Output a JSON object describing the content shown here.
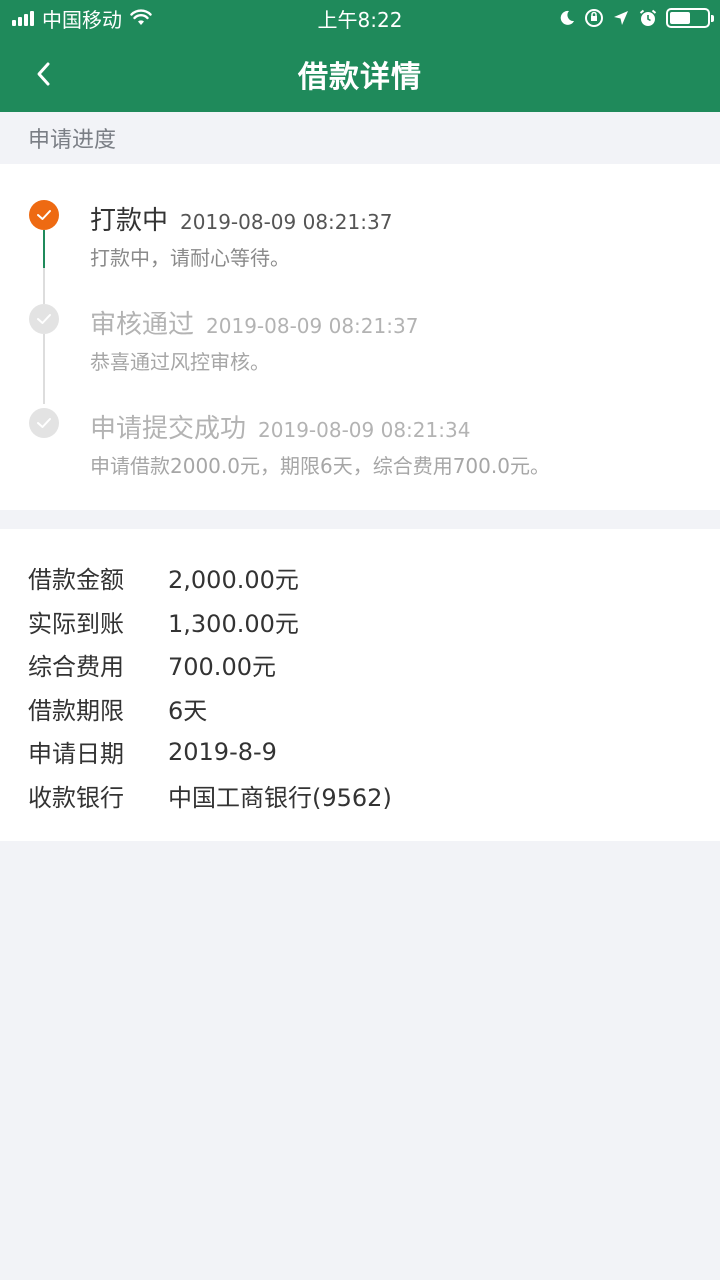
{
  "status_bar": {
    "carrier": "中国移动",
    "time": "上午8:22"
  },
  "header": {
    "title": "借款详情"
  },
  "progress": {
    "section_title": "申请进度",
    "steps": [
      {
        "title": "打款中",
        "time": "2019-08-09 08:21:37",
        "desc": "打款中，请耐心等待。",
        "state": "active"
      },
      {
        "title": "审核通过",
        "time": "2019-08-09 08:21:37",
        "desc": "恭喜通过风控审核。",
        "state": "done"
      },
      {
        "title": "申请提交成功",
        "time": "2019-08-09 08:21:34",
        "desc": "申请借款2000.0元，期限6天，综合费用700.0元。",
        "state": "done"
      }
    ]
  },
  "details": [
    {
      "label": "借款金额",
      "value": "2,000.00元"
    },
    {
      "label": "实际到账",
      "value": "1,300.00元"
    },
    {
      "label": "综合费用",
      "value": "700.00元"
    },
    {
      "label": "借款期限",
      "value": "6天"
    },
    {
      "label": "申请日期",
      "value": "2019-8-9"
    },
    {
      "label": "收款银行",
      "value": "中国工商银行(9562)"
    }
  ],
  "colors": {
    "brand": "#1f8a5b",
    "active_step": "#ee6a12",
    "inactive_step": "#e3e3e3"
  }
}
